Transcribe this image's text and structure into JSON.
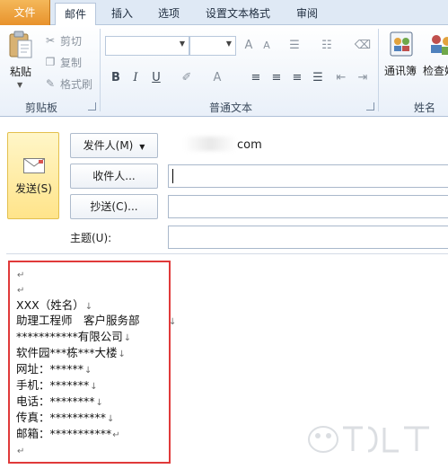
{
  "tabs": [
    "文件",
    "邮件",
    "插入",
    "选项",
    "设置文本格式",
    "审阅"
  ],
  "ribbon": {
    "clipboard": {
      "paste": "粘贴",
      "cut": "剪切",
      "copy": "复制",
      "format_painter": "格式刷",
      "group_label": "剪贴板"
    },
    "font": {
      "group_label": "普通文本",
      "bold": "B",
      "italic": "I",
      "underline": "U",
      "grow": "A",
      "shrink": "A",
      "font_color": "A"
    },
    "names": {
      "address_book": "通讯簿",
      "check_names": "检查姓",
      "group_label": "姓名"
    }
  },
  "compose": {
    "send_label": "发送(S)",
    "from_button": "发件人(M)",
    "from_value": "com",
    "to_button": "收件人...",
    "cc_button": "抄送(C)...",
    "subject_label": "主题(U):"
  },
  "signature": {
    "paragraph_mark": "↵",
    "line_break_mark": "↓",
    "lines": [
      "XXX（姓名）",
      "助理工程师　客户服务部",
      "***********有限公司",
      "软件园***栋***大楼",
      "网址：******",
      "手机：*******",
      "电话：********",
      "传真：**********",
      "邮箱：***********"
    ]
  },
  "colors": {
    "file_tab": "#e8922c",
    "send_button": "#ffe48a",
    "highlight_box": "#e03a3a",
    "ribbon_bg": "#dfe9f5"
  },
  "icons": [
    "paste-icon",
    "scissors-icon",
    "copy-icon",
    "format-painter-icon",
    "envelope-icon",
    "address-book-icon",
    "check-names-icon"
  ]
}
